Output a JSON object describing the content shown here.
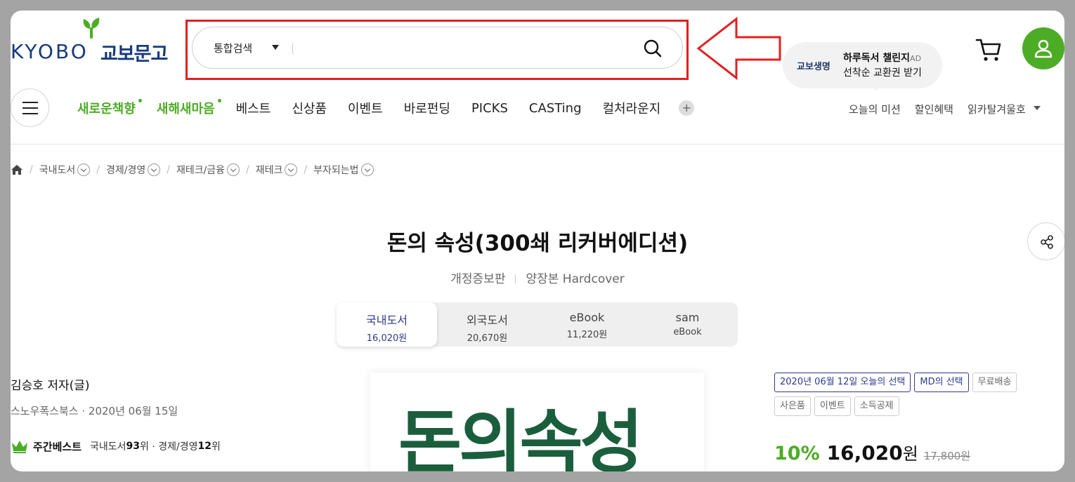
{
  "header": {
    "logo_en": "KYOBO",
    "logo_ko": "교보문고",
    "search": {
      "category": "통합검색",
      "placeholder": "",
      "value": ""
    },
    "ad": {
      "brand": "교보생명",
      "line1": "하루독서 챌린지",
      "tag": "AD",
      "line2": "선착순 교환권 받기"
    }
  },
  "nav": {
    "items": [
      {
        "label": "새로운책향"
      },
      {
        "label": "새해새마음"
      },
      {
        "label": "베스트"
      },
      {
        "label": "신상품"
      },
      {
        "label": "이벤트"
      },
      {
        "label": "바로펀딩"
      },
      {
        "label": "PICKS"
      },
      {
        "label": "CASTing"
      },
      {
        "label": "컬처라운지"
      }
    ],
    "plus": "+",
    "right": [
      "오늘의 미션",
      "할인혜택",
      "읽카탈겨울호"
    ]
  },
  "breadcrumb": [
    "국내도서",
    "경제/경영",
    "재테크/금융",
    "재테크",
    "부자되는법"
  ],
  "product": {
    "title": "돈의 속성(300쇄 리커버에디션)",
    "edition": "개정증보판",
    "binding": "양장본 Hardcover",
    "formats": [
      {
        "name": "국내도서",
        "price": "16,020원"
      },
      {
        "name": "외국도서",
        "price": "20,670원"
      },
      {
        "name": "eBook",
        "price": "11,220원"
      },
      {
        "name": "sam",
        "price": "eBook"
      }
    ],
    "author": "김승호 저자(글)",
    "publisher_date": "스노우폭스북스 · 2020년 06월 15일",
    "rank": {
      "label": "주간베스트",
      "text1": "국내도서 ",
      "rank1": "93",
      "text2": "위 · 경제/경영 ",
      "rank2": "12",
      "text3": "위"
    },
    "cover_text": "돈의속성",
    "badges": [
      {
        "label": "2020년 06월 12일 오늘의 선택",
        "style": "blue"
      },
      {
        "label": "MD의 선택",
        "style": "blue"
      },
      {
        "label": "무료배송",
        "style": "gray"
      },
      {
        "label": "사은품",
        "style": "gray"
      },
      {
        "label": "이벤트",
        "style": "gray"
      },
      {
        "label": "소득공제",
        "style": "gray"
      }
    ],
    "discount": "10%",
    "price": "16,020",
    "currency": "원",
    "original_price": "17,800원"
  },
  "colors": {
    "brand_green": "#4dac26",
    "brand_navy": "#163a7c",
    "annotation_red": "#e02020"
  }
}
